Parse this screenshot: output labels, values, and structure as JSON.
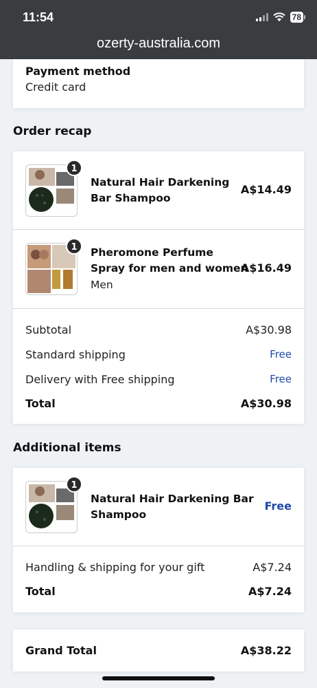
{
  "status": {
    "time": "11:54",
    "battery": "78"
  },
  "browser": {
    "url": "ozerty-australia.com"
  },
  "payment": {
    "title": "Payment method",
    "value": "Credit card"
  },
  "order_recap": {
    "title": "Order recap",
    "items": [
      {
        "name_line1": "Natural Hair Darkening",
        "name_line2": "Bar Shampoo",
        "variant": "",
        "qty": "1",
        "price": "A$14.49"
      },
      {
        "name_line1": "Pheromone Perfume",
        "name_line2": "Spray for men and women",
        "variant": "Men",
        "qty": "1",
        "price": "A$16.49"
      }
    ],
    "subtotal_label": "Subtotal",
    "subtotal": "A$30.98",
    "standard_shipping_label": "Standard shipping",
    "standard_shipping": "Free",
    "delivery_label": "Delivery with Free shipping",
    "delivery": "Free",
    "total_label": "Total",
    "total": "A$30.98"
  },
  "additional": {
    "title": "Additional items",
    "item": {
      "name_line1": "Natural Hair Darkening Bar",
      "name_line2": "Shampoo",
      "qty": "1",
      "price": "Free"
    },
    "handling_label": "Handling & shipping for your gift",
    "handling": "A$7.24",
    "total_label": "Total",
    "total": "A$7.24"
  },
  "grand_total": {
    "label": "Grand Total",
    "value": "A$38.22"
  },
  "colors": {
    "chrome": "#3a3d40",
    "link_blue": "#1f4aa8",
    "background": "#eef2f5"
  }
}
